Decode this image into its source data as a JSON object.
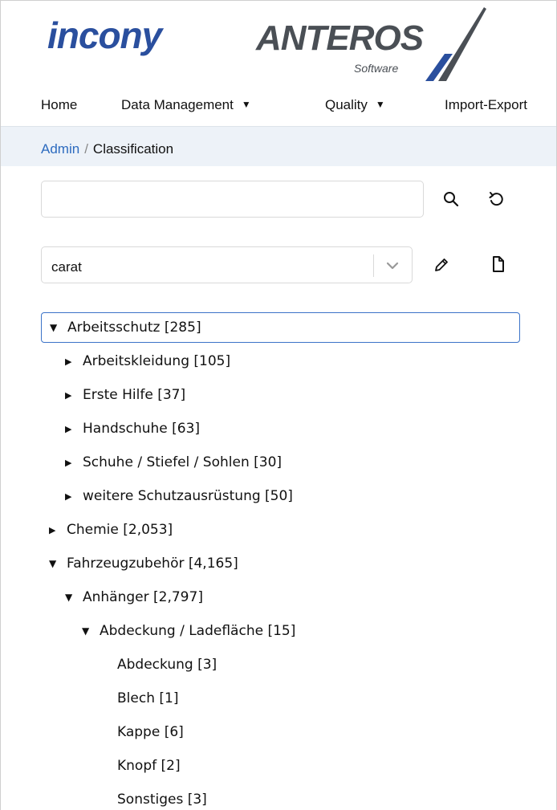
{
  "header": {
    "logo_left": "incony",
    "logo_right": "ANTEROS",
    "logo_right_sub": "Software"
  },
  "nav": {
    "items": [
      {
        "label": "Home",
        "has_dropdown": false
      },
      {
        "label": "Data Management",
        "has_dropdown": true
      },
      {
        "label": "Quality",
        "has_dropdown": true
      },
      {
        "label": "Import-Export",
        "has_dropdown": false
      }
    ]
  },
  "breadcrumb": {
    "parent": "Admin",
    "separator": "/",
    "current": "Classification"
  },
  "search": {
    "value": "",
    "placeholder": "",
    "search_icon": "search-icon",
    "reset_icon": "reset-icon"
  },
  "classification_select": {
    "selected": "carat",
    "edit_icon": "pencil-icon",
    "new_icon": "new-document-icon"
  },
  "tree": [
    {
      "label": "Arbeitsschutz [285]",
      "state": "expanded",
      "selected": true
    },
    {
      "label": "Arbeitskleidung [105]",
      "state": "collapsed"
    },
    {
      "label": "Erste Hilfe [37]",
      "state": "collapsed"
    },
    {
      "label": "Handschuhe [63]",
      "state": "collapsed"
    },
    {
      "label": "Schuhe / Stiefel / Sohlen [30]",
      "state": "collapsed"
    },
    {
      "label": "weitere Schutzausrüstung [50]",
      "state": "collapsed"
    },
    {
      "label": "Chemie [2,053]",
      "state": "collapsed"
    },
    {
      "label": "Fahrzeugzubehör [4,165]",
      "state": "expanded"
    },
    {
      "label": "Anhänger [2,797]",
      "state": "expanded"
    },
    {
      "label": "Abdeckung / Ladefläche [15]",
      "state": "expanded"
    },
    {
      "label": "Abdeckung [3]",
      "state": "leaf"
    },
    {
      "label": "Blech [1]",
      "state": "leaf"
    },
    {
      "label": "Kappe [6]",
      "state": "leaf"
    },
    {
      "label": "Knopf [2]",
      "state": "leaf"
    },
    {
      "label": "Sonstiges [3]",
      "state": "leaf"
    }
  ]
}
